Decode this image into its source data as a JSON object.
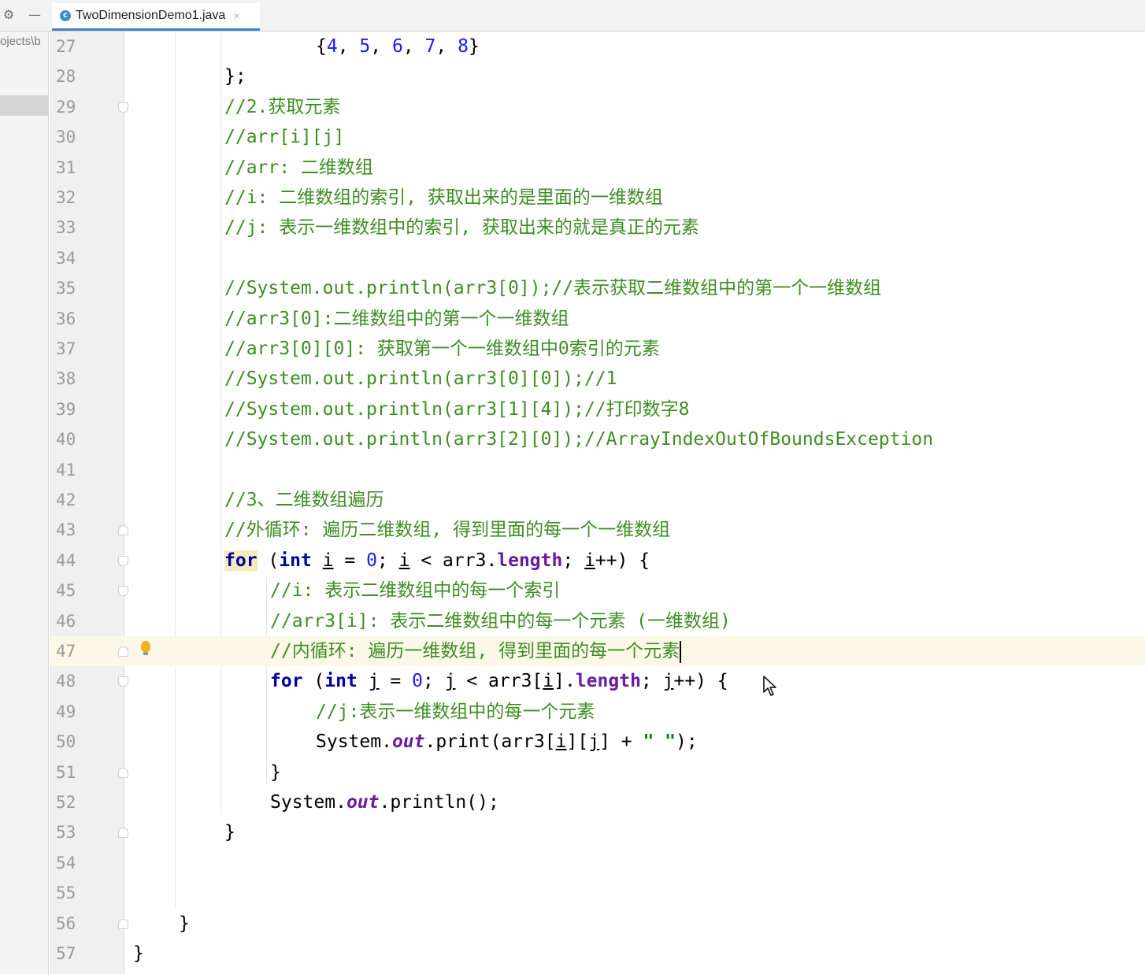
{
  "toolbar": {
    "settings_icon": "gear-icon",
    "minimize_icon": "minus-icon"
  },
  "tab": {
    "title": "TwoDimensionDemo1.java",
    "close": "×",
    "icon": "class-icon"
  },
  "project": {
    "path": "ojects\\b"
  },
  "editor": {
    "current_line": "47",
    "lines": [
      {
        "n": "27",
        "text": "{4, 5, 6, 7, 8}"
      },
      {
        "n": "28",
        "text": "};"
      },
      {
        "n": "29",
        "text": "//2.获取元素"
      },
      {
        "n": "30",
        "text": "//arr[i][j]"
      },
      {
        "n": "31",
        "text": "//arr: 二维数组"
      },
      {
        "n": "32",
        "text": "//i: 二维数组的索引, 获取出来的是里面的一维数组"
      },
      {
        "n": "33",
        "text": "//j: 表示一维数组中的索引, 获取出来的就是真正的元素"
      },
      {
        "n": "34",
        "text": ""
      },
      {
        "n": "35",
        "text": "//System.out.println(arr3[0]);//表示获取二维数组中的第一个一维数组"
      },
      {
        "n": "36",
        "text": "//arr3[0]:二维数组中的第一个一维数组"
      },
      {
        "n": "37",
        "text": "//arr3[0][0]: 获取第一个一维数组中0索引的元素"
      },
      {
        "n": "38",
        "text": "//System.out.println(arr3[0][0]);//1"
      },
      {
        "n": "39",
        "text": "//System.out.println(arr3[1][4]);//打印数字8"
      },
      {
        "n": "40",
        "text": "//System.out.println(arr3[2][0]);//ArrayIndexOutOfBoundsException"
      },
      {
        "n": "41",
        "text": ""
      },
      {
        "n": "42",
        "text": "//3、二维数组遍历"
      },
      {
        "n": "43",
        "text": "//外循环: 遍历二维数组, 得到里面的每一个一维数组"
      },
      {
        "n": "44",
        "text": "for (int i = 0; i < arr3.length; i++) {"
      },
      {
        "n": "45",
        "text": "//i: 表示二维数组中的每一个索引"
      },
      {
        "n": "46",
        "text": "//arr3[i]: 表示二维数组中的每一个元素 (一维数组)"
      },
      {
        "n": "47",
        "text": "//内循环: 遍历一维数组, 得到里面的每一个元素"
      },
      {
        "n": "48",
        "text": "for (int j = 0; j < arr3[i].length; j++) {"
      },
      {
        "n": "49",
        "text": "//j:表示一维数组中的每一个元素"
      },
      {
        "n": "50",
        "text": "System.out.print(arr3[i][j] + \" \");"
      },
      {
        "n": "51",
        "text": "}"
      },
      {
        "n": "52",
        "text": "System.out.println();"
      },
      {
        "n": "53",
        "text": "}"
      },
      {
        "n": "54",
        "text": ""
      },
      {
        "n": "55",
        "text": ""
      },
      {
        "n": "56",
        "text": "}"
      },
      {
        "n": "57",
        "text": "}"
      }
    ]
  },
  "tokens": {
    "l27": [
      "{",
      "4",
      ", ",
      "5",
      ", ",
      "6",
      ", ",
      "7",
      ", ",
      "8",
      "}"
    ],
    "l44": [
      "for",
      " (",
      "int",
      " ",
      "i",
      " = ",
      "0",
      "; ",
      "i",
      " < arr3.",
      "length",
      "; ",
      "i",
      "++) {"
    ],
    "l48": [
      "for",
      " (",
      "int",
      " ",
      "j",
      " = ",
      "0",
      "; ",
      "j",
      " < arr3[",
      "i",
      "].",
      "length",
      "; ",
      "j",
      "++) {"
    ],
    "l50": [
      "System.",
      "out",
      ".print(arr3[",
      "i",
      "][",
      "j",
      "] + ",
      "\" \"",
      ");"
    ],
    "l52": [
      "System.",
      "out",
      ".println();"
    ]
  },
  "colors": {
    "comment": "#3e8e24",
    "keyword": "#0000a0",
    "number": "#1a1aff",
    "field": "#6a1b9a",
    "string": "#127a12",
    "current_line": "#fcf8e8",
    "tab_underline": "#4083c9",
    "bulb": "#f2b21c"
  }
}
